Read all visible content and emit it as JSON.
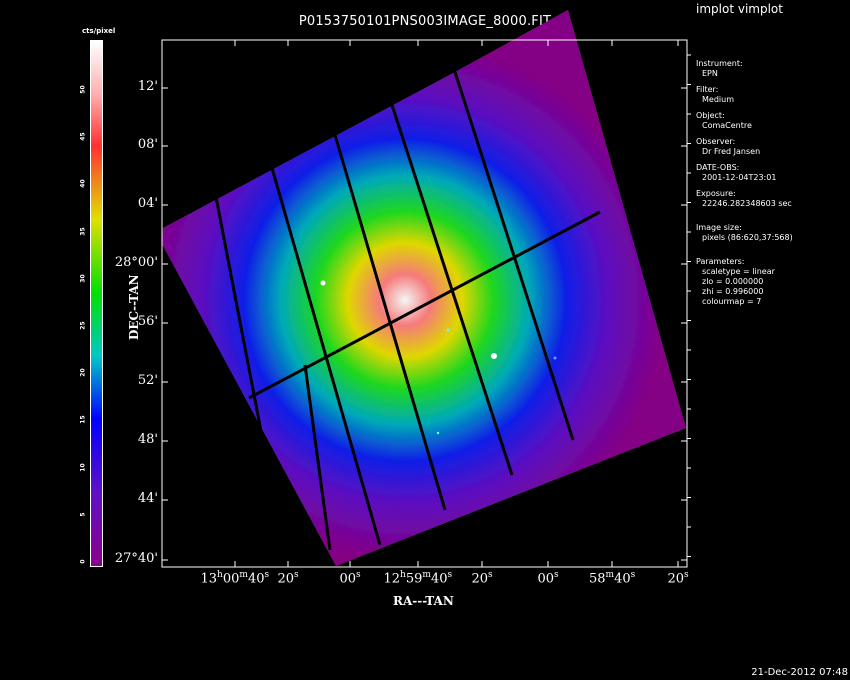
{
  "window": {
    "app_title": "implot vimplot",
    "plot_title": "P0153750101PNS003IMAGE_8000.FIT",
    "timestamp": "21-Dec-2012 07:48"
  },
  "colorbar": {
    "label": "cts/pixel",
    "ticks": [
      "0",
      "5",
      "10",
      "15",
      "20",
      "25",
      "30",
      "35",
      "40",
      "45",
      "50"
    ]
  },
  "axes": {
    "xlabel": "RA---TAN",
    "ylabel": "DEC--TAN",
    "y_ticks": [
      {
        "deg": "",
        "min": "12'",
        "sec": ""
      },
      {
        "deg": "",
        "min": "08'",
        "sec": ""
      },
      {
        "deg": "",
        "min": "04'",
        "sec": ""
      },
      {
        "deg": "28°",
        "min": "00'",
        "sec": ""
      },
      {
        "deg": "",
        "min": "56'",
        "sec": ""
      },
      {
        "deg": "",
        "min": "52'",
        "sec": ""
      },
      {
        "deg": "",
        "min": "48'",
        "sec": ""
      },
      {
        "deg": "",
        "min": "44'",
        "sec": ""
      },
      {
        "deg": "27°",
        "min": "40'",
        "sec": ""
      }
    ],
    "x_ticks": [
      {
        "h": "13",
        "m": "00",
        "s": "40"
      },
      {
        "h": "",
        "m": "",
        "s": "20"
      },
      {
        "h": "",
        "m": "",
        "s": "00"
      },
      {
        "h": "12",
        "m": "59",
        "s": "40"
      },
      {
        "h": "",
        "m": "",
        "s": "20"
      },
      {
        "h": "",
        "m": "",
        "s": "00"
      },
      {
        "h": "",
        "m": "58",
        "s": "40"
      },
      {
        "h": "",
        "m": "",
        "s": "20"
      }
    ]
  },
  "info_panel": [
    {
      "key": "Instrument:",
      "value": "EPN"
    },
    {
      "key": "Filter:",
      "value": "Medium"
    },
    {
      "key": "Object:",
      "value": "ComaCentre"
    },
    {
      "key": "Observer:",
      "value": "Dr Fred Jansen"
    },
    {
      "key": "DATE-OBS:",
      "value": "2001-12-04T23:01"
    },
    {
      "key": "Exposure:",
      "value": "22246.282348603 sec"
    },
    {
      "key": "Image size:",
      "value": "pixels (86:620,37:568)"
    },
    {
      "key": "Parameters:",
      "lines": [
        "scaletype = linear",
        "zlo = 0.000000",
        "zhi = 0.996000",
        "colourmap =   7"
      ]
    }
  ],
  "colors": {
    "background": "#000000",
    "frame": "#ffffff",
    "low": "#8a008a",
    "mid_blue": "#0000ff",
    "cyan": "#00c8c8",
    "green": "#00e000",
    "yellow": "#e0e000",
    "red": "#ff3030",
    "high": "#ffffff"
  }
}
